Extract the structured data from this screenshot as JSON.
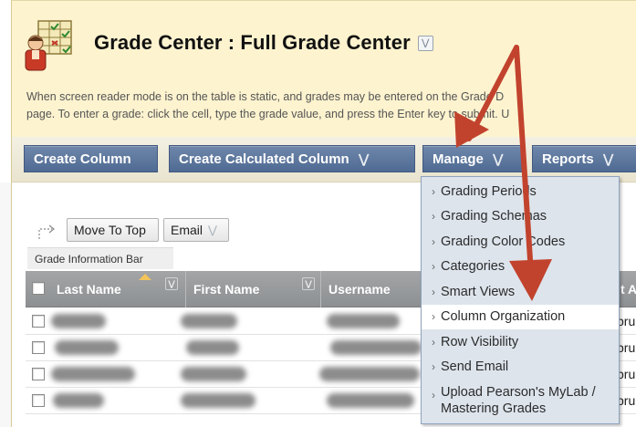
{
  "header": {
    "title": "Grade Center : Full Grade Center",
    "description_line1": "When screen reader mode is on the table is static, and grades may be entered on the Grade D",
    "description_line2": "page. To enter a grade: click the cell, type the grade value, and press the Enter key to submit. U"
  },
  "action_bar": {
    "create_column": "Create Column",
    "create_calculated_column": "Create Calculated Column",
    "manage": "Manage",
    "reports": "Reports"
  },
  "toolbar": {
    "move_to_top": "Move To Top",
    "email": "Email"
  },
  "info_bar": "Grade Information Bar",
  "grid": {
    "columns": [
      "Last Name",
      "First Name",
      "Username",
      "t A"
    ],
    "row_edge_text": [
      "pru",
      "pru",
      "pru",
      "pru"
    ]
  },
  "manage_menu": {
    "items": [
      "Grading Periods",
      "Grading Schemas",
      "Grading Color Codes",
      "Categories",
      "Smart Views",
      "Column Organization",
      "Row Visibility",
      "Send Email",
      "Upload Pearson's MyLab / Mastering Grades"
    ],
    "active_index": 5
  },
  "colors": {
    "header_bg": "#fdf3cf",
    "action_button": "#5a7399",
    "menu_bg": "#dde4ec",
    "annotation_arrow": "#c2432d"
  }
}
